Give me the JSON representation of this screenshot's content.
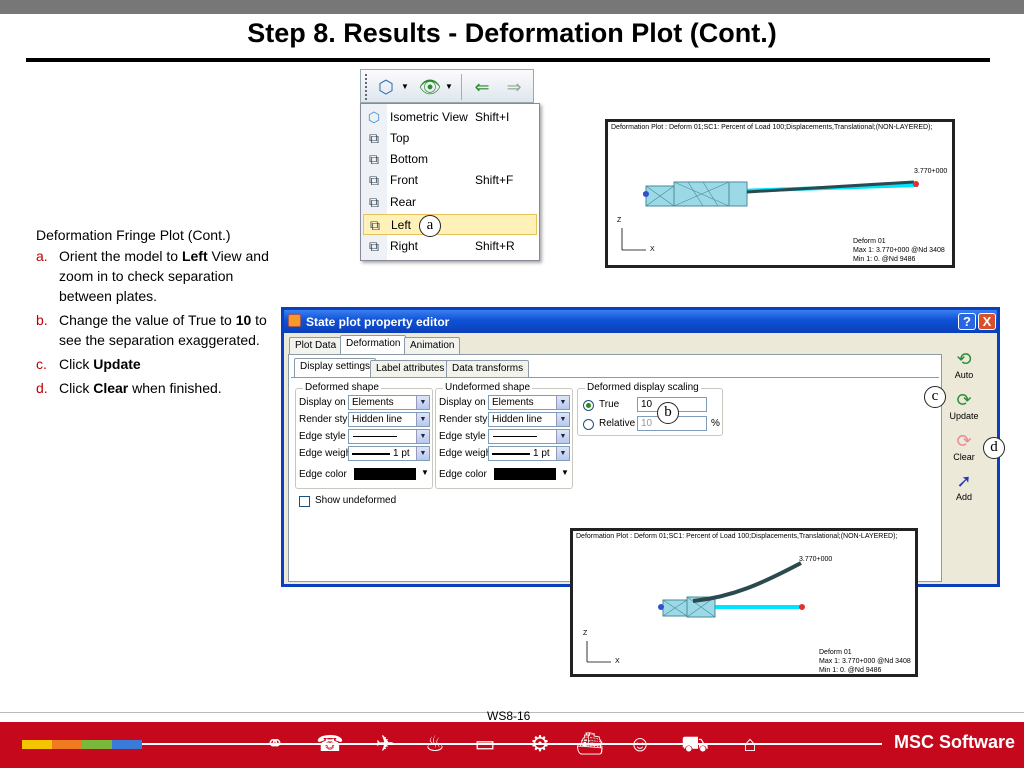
{
  "slide": {
    "title": "Step 8. Results - Deformation Plot (Cont.)",
    "page_number": "WS8-16"
  },
  "toolbar": {
    "items": [
      {
        "icon": "isometric-view-icon"
      },
      {
        "icon": "dropdown-arrow-icon"
      },
      {
        "icon": "show-eye-icon"
      },
      {
        "icon": "dropdown-arrow-icon"
      },
      {
        "icon": "eye-back-icon"
      },
      {
        "icon": "eye-forward-icon"
      }
    ]
  },
  "view_menu": {
    "items": [
      {
        "label": "Isometric View",
        "shortcut": "Shift+I",
        "icon": "isometric-cube-icon"
      },
      {
        "label": "Top",
        "shortcut": "",
        "icon": "top-view-icon"
      },
      {
        "label": "Bottom",
        "shortcut": "",
        "icon": "bottom-view-icon"
      },
      {
        "label": "Front",
        "shortcut": "Shift+F",
        "icon": "front-view-icon"
      },
      {
        "label": "Rear",
        "shortcut": "",
        "icon": "rear-view-icon"
      },
      {
        "label": "Left",
        "shortcut": "",
        "icon": "left-view-icon",
        "selected": true
      },
      {
        "label": "Right",
        "shortcut": "Shift+R",
        "icon": "right-view-icon"
      }
    ]
  },
  "markers": {
    "a": "a",
    "b": "b",
    "c": "c",
    "d": "d"
  },
  "plot_top": {
    "title": "Deformation Plot : Deform 01;SC1: Percent of Load 100;Displacements,Translational;(NON-LAYERED);",
    "max_label": "3.770+000",
    "legend": [
      "Deform 01",
      "Max 1:  3.770+000 @Nd 3408",
      "Min 1:    0. @Nd 9486"
    ],
    "axis_z": "Z",
    "axis_x": "X"
  },
  "plot_bottom": {
    "title": "Deformation Plot : Deform 01;SC1: Percent of Load 100;Displacements,Translational;(NON-LAYERED);",
    "max_label": "3.770+000",
    "legend": [
      "Deform 01",
      "Max 1: 3.770+000 @Nd 3408",
      "Min 1:    0. @Nd 9486"
    ],
    "axis_z": "Z",
    "axis_x": "X"
  },
  "notes": {
    "heading": "Deformation Fringe Plot (Cont.)",
    "steps": [
      {
        "letter": "a.",
        "pre": "Orient the model to ",
        "bold": "Left",
        "post": " View and zoom in to check separation between plates."
      },
      {
        "letter": "b.",
        "pre": "Change the value of True to ",
        "bold": "10",
        "post": " to see the separation exaggerated."
      },
      {
        "letter": "c.",
        "pre": "Click ",
        "bold": "Update",
        "post": ""
      },
      {
        "letter": "d.",
        "pre": "Click ",
        "bold": "Clear",
        "post": " when finished."
      }
    ]
  },
  "dialog": {
    "title": "State plot property editor",
    "help_button": "?",
    "close_button": "X",
    "tabs": [
      "Plot Data",
      "Deformation",
      "Animation"
    ],
    "subtabs": [
      "Display settings",
      "Label attributes",
      "Data transforms"
    ],
    "deformed_shape": {
      "label": "Deformed shape",
      "display_on_label": "Display on",
      "display_on_value": "Elements",
      "render_style_label": "Render style",
      "render_style_value": "Hidden line",
      "edge_style_label": "Edge style",
      "edge_weight_label": "Edge weight",
      "edge_weight_value": "1 pt",
      "edge_color_label": "Edge color"
    },
    "undeformed_shape": {
      "label": "Undeformed shape",
      "display_on_label": "Display on",
      "display_on_value": "Elements",
      "render_style_label": "Render style",
      "render_style_value": "Hidden line",
      "edge_style_label": "Edge style",
      "edge_weight_label": "Edge weight",
      "edge_weight_value": "1 pt",
      "edge_color_label": "Edge color"
    },
    "scaling": {
      "label": "Deformed display scaling",
      "true_label": "True",
      "true_value": "10",
      "relative_label": "Relative",
      "relative_value": "10",
      "percent": "%"
    },
    "show_undeformed": "Show undeformed",
    "side_buttons": [
      "Auto",
      "Update",
      "Clear",
      "Add"
    ]
  },
  "colors": {
    "title_bar": "#0f52d6",
    "footer": "#c5081b",
    "accent_red": "#c00000"
  },
  "footer": {
    "logo": "MSC Software"
  }
}
